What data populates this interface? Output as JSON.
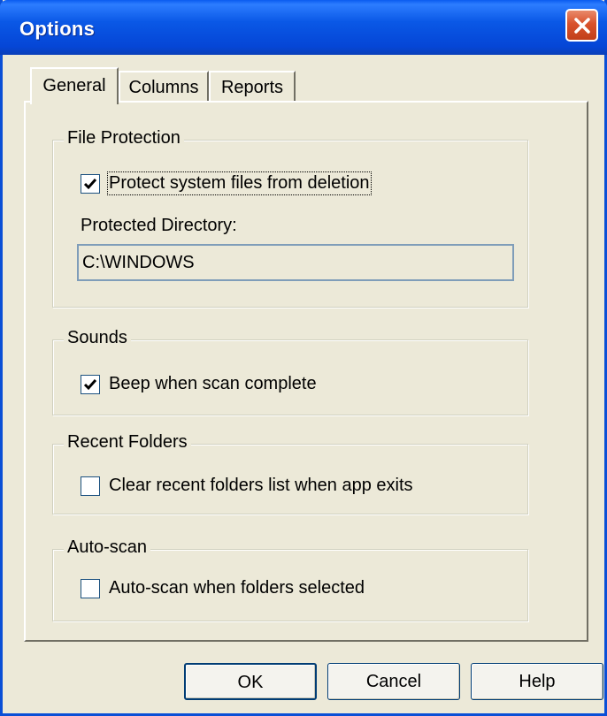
{
  "window": {
    "title": "Options"
  },
  "tabs": [
    {
      "label": "General"
    },
    {
      "label": "Columns"
    },
    {
      "label": "Reports"
    }
  ],
  "file_protection": {
    "title": "File Protection",
    "protect_label": "Protect system files from deletion",
    "protect_checked": true,
    "dir_label": "Protected Directory:",
    "dir_value": "C:\\WINDOWS"
  },
  "sounds": {
    "title": "Sounds",
    "beep_label": "Beep when scan complete",
    "beep_checked": true
  },
  "recent_folders": {
    "title": "Recent Folders",
    "clear_label": "Clear recent folders list when app exits",
    "clear_checked": false
  },
  "auto_scan": {
    "title": "Auto-scan",
    "scan_label": "Auto-scan when folders selected",
    "scan_checked": false
  },
  "buttons": {
    "ok": "OK",
    "cancel": "Cancel",
    "help": "Help"
  },
  "colors": {
    "titlebar": "#0a58e6",
    "close": "#d9522c",
    "face": "#ece9d8"
  },
  "icons": {
    "close": "close-icon",
    "check": "checkmark-icon"
  }
}
